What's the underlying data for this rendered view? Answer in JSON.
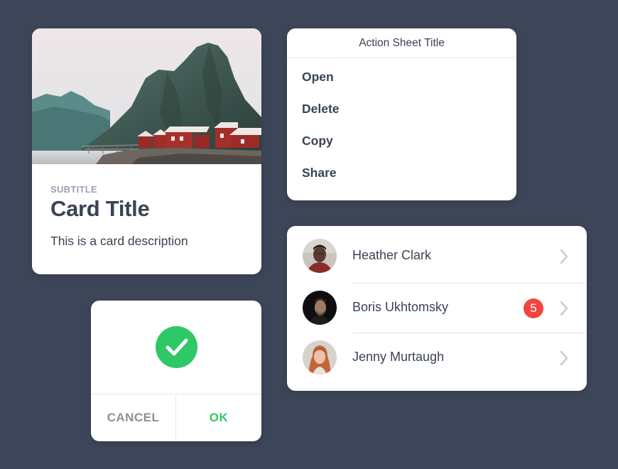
{
  "card": {
    "subtitle": "SUBTITLE",
    "title": "Card Title",
    "description": "This is a card description",
    "image": "mountain-lake-village-photo"
  },
  "action_sheet": {
    "title": "Action Sheet Title",
    "items": [
      {
        "label": "Open"
      },
      {
        "label": "Delete"
      },
      {
        "label": "Copy"
      },
      {
        "label": "Share"
      }
    ]
  },
  "contacts": {
    "items": [
      {
        "name": "Heather Clark",
        "badge": "",
        "avatar": "person-avatar",
        "chevron": "chevron-right-icon"
      },
      {
        "name": "Boris Ukhtomsky",
        "badge": "5",
        "avatar": "person-avatar",
        "chevron": "chevron-right-icon"
      },
      {
        "name": "Jenny Murtaugh",
        "badge": "",
        "avatar": "person-avatar",
        "chevron": "chevron-right-icon"
      }
    ]
  },
  "dialog": {
    "icon": "check-circle-icon",
    "cancel_label": "CANCEL",
    "ok_label": "OK"
  },
  "colors": {
    "background": "#3d4658",
    "text": "#3a4354",
    "muted": "#9aa1ad",
    "success": "#2ec866",
    "badge": "#f0463f"
  }
}
